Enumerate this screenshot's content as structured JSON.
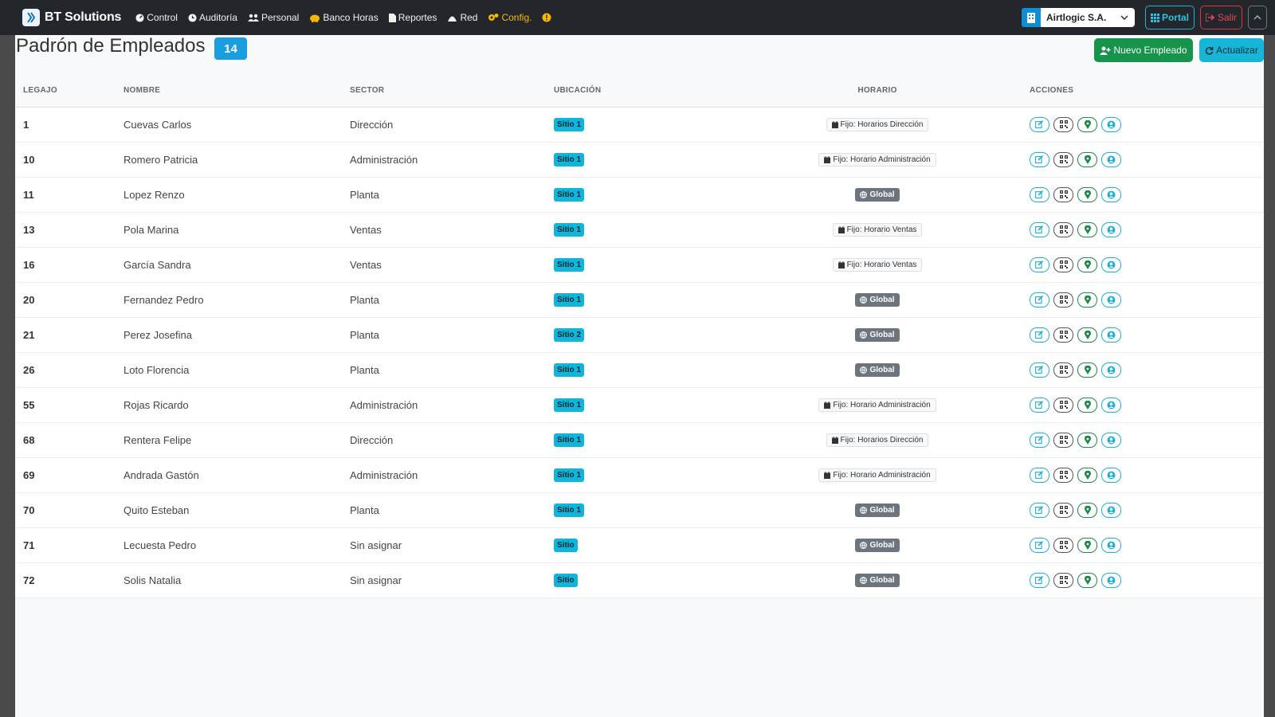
{
  "brand": {
    "name": "BT Solutions"
  },
  "nav": {
    "items": [
      {
        "label": "Control",
        "icon": "gauge-icon"
      },
      {
        "label": "Auditoría",
        "icon": "clock-icon"
      },
      {
        "label": "Personal",
        "icon": "users-icon"
      },
      {
        "label": "Banco Horas",
        "icon": "piggy-bank-icon"
      },
      {
        "label": "Reportes",
        "icon": "file-icon"
      },
      {
        "label": "Red",
        "icon": "network-icon"
      },
      {
        "label": "Config.",
        "icon": "cogs-icon"
      }
    ],
    "company": "Airtlogic S.A.",
    "portal_label": "Portal",
    "salir_label": "Salir"
  },
  "page": {
    "title": "Padrón de Empleados",
    "count": "14",
    "nuevo_label": "Nuevo Empleado",
    "actualizar_label": "Actualizar"
  },
  "table": {
    "headers": [
      "LEGAJO",
      "NOMBRE",
      "SECTOR",
      "UBICACIÓN",
      "HORARIO",
      "ACCIONES"
    ],
    "rows": [
      {
        "legajo": "1",
        "nombre": "Cuevas Carlos",
        "sector": "Dirección",
        "ubicacion": "Sitio 1",
        "horario": "Fijo: Horarios Dirección",
        "horario_type": "fijo"
      },
      {
        "legajo": "10",
        "nombre": "Romero Patricia",
        "sector": "Administración",
        "ubicacion": "Sitio 1",
        "horario": "Fijo: Horario Administración",
        "horario_type": "fijo"
      },
      {
        "legajo": "11",
        "nombre": "Lopez Renzo",
        "sector": "Planta",
        "ubicacion": "Sitio 1",
        "horario": "Global",
        "horario_type": "global"
      },
      {
        "legajo": "13",
        "nombre": "Pola Marina",
        "sector": "Ventas",
        "ubicacion": "Sitio 1",
        "horario": "Fijo: Horario Ventas",
        "horario_type": "fijo"
      },
      {
        "legajo": "16",
        "nombre": "García Sandra",
        "sector": "Ventas",
        "ubicacion": "Sitio 1",
        "horario": "Fijo: Horario Ventas",
        "horario_type": "fijo"
      },
      {
        "legajo": "20",
        "nombre": "Fernandez Pedro",
        "sector": "Planta",
        "ubicacion": "Sitio 1",
        "horario": "Global",
        "horario_type": "global"
      },
      {
        "legajo": "21",
        "nombre": "Perez Josefina",
        "sector": "Planta",
        "ubicacion": "Sitio 2",
        "horario": "Global",
        "horario_type": "global"
      },
      {
        "legajo": "26",
        "nombre": "Loto Florencia",
        "sector": "Planta",
        "ubicacion": "Sitio 1",
        "horario": "Global",
        "horario_type": "global"
      },
      {
        "legajo": "55",
        "nombre": "Rojas Ricardo",
        "sector": "Administración",
        "ubicacion": "Sitio 1",
        "horario": "Fijo: Horario Administración",
        "horario_type": "fijo"
      },
      {
        "legajo": "68",
        "nombre": "Rentera Felipe",
        "sector": "Dirección",
        "ubicacion": "Sitio 1",
        "horario": "Fijo: Horarios Dirección",
        "horario_type": "fijo"
      },
      {
        "legajo": "69",
        "nombre": "Andrada Gastón",
        "sector": "Administración",
        "ubicacion": "Sitio 1",
        "horario": "Fijo: Horario Administración",
        "horario_type": "fijo"
      },
      {
        "legajo": "70",
        "nombre": "Quito Esteban",
        "sector": "Planta",
        "ubicacion": "Sitio 1",
        "horario": "Global",
        "horario_type": "global"
      },
      {
        "legajo": "71",
        "nombre": "Lecuesta Pedro",
        "sector": "Sin asignar",
        "ubicacion": "Sitio",
        "horario": "Global",
        "horario_type": "global"
      },
      {
        "legajo": "72",
        "nombre": "Solis Natalia",
        "sector": "Sin asignar",
        "ubicacion": "Sitio",
        "horario": "Global",
        "horario_type": "global"
      }
    ]
  },
  "colors": {
    "navbar_bg": "#23272b",
    "primary": "#1a9ee0",
    "success": "#17944b",
    "info": "#17b6d9",
    "danger": "#dc3545",
    "warning": "#f5b800"
  }
}
